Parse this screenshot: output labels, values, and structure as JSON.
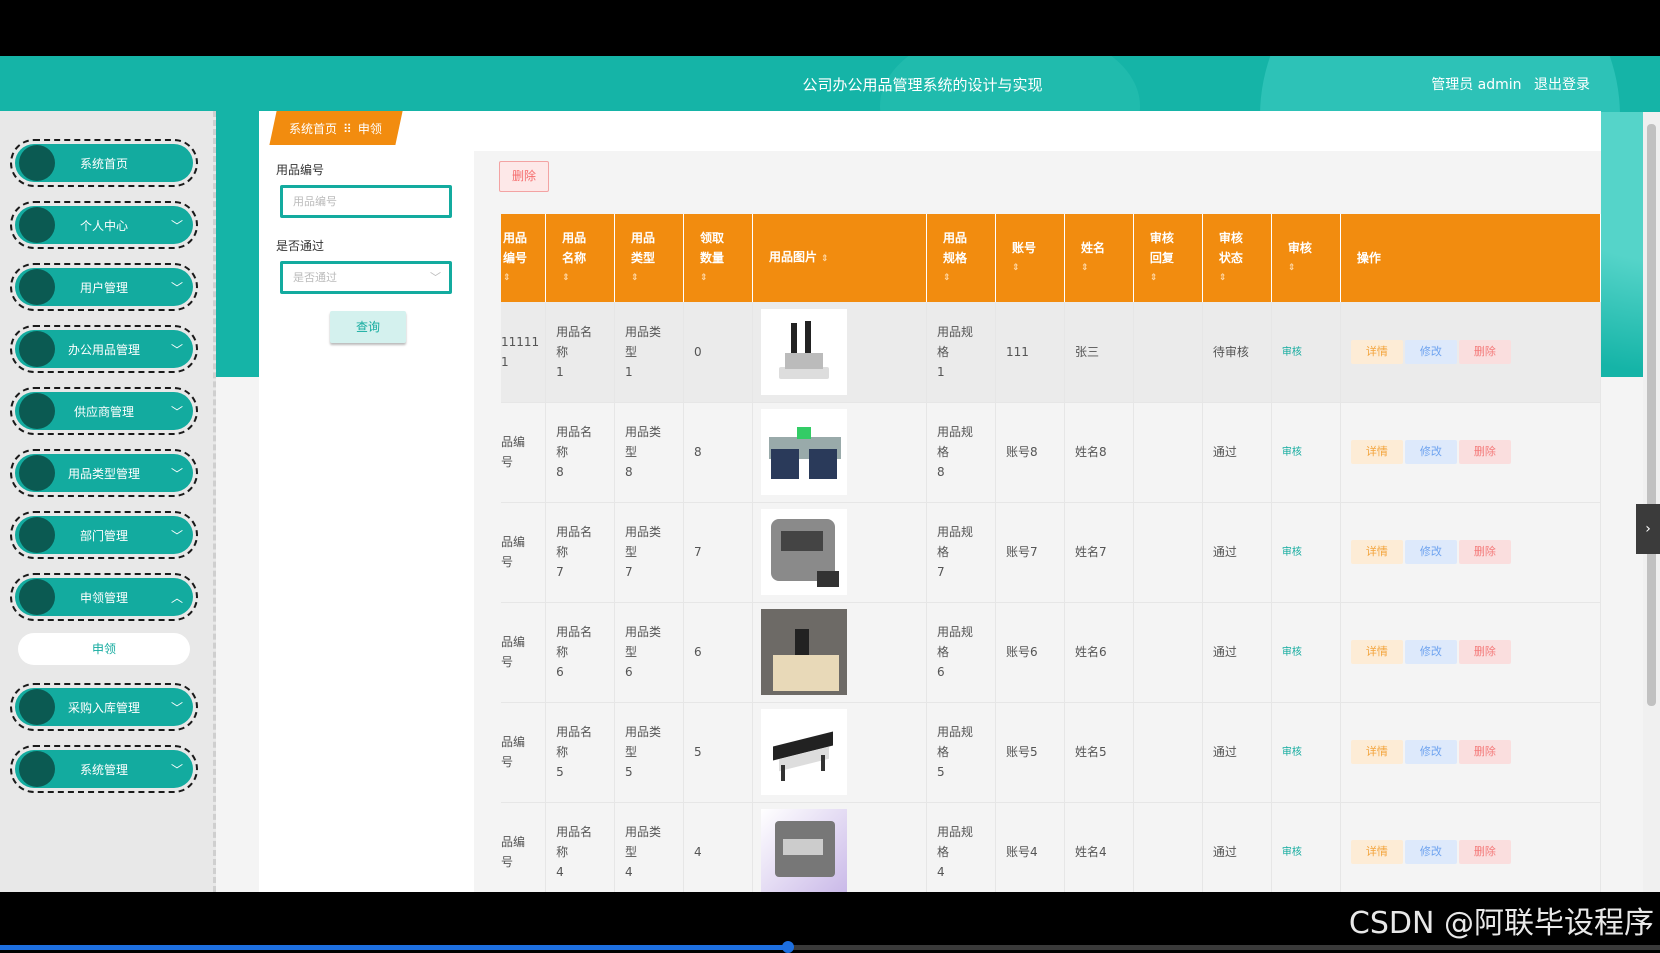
{
  "header": {
    "title": "公司办公用品管理系统的设计与实现",
    "role": "管理员 admin",
    "logout": "退出登录"
  },
  "sidebar": {
    "items": [
      {
        "label": "系统首页",
        "chevron": ""
      },
      {
        "label": "个人中心",
        "chevron": "﹀"
      },
      {
        "label": "用户管理",
        "chevron": "﹀"
      },
      {
        "label": "办公用品管理",
        "chevron": "﹀"
      },
      {
        "label": "供应商管理",
        "chevron": "﹀"
      },
      {
        "label": "用品类型管理",
        "chevron": "﹀"
      },
      {
        "label": "部门管理",
        "chevron": "﹀"
      },
      {
        "label": "申领管理",
        "chevron": "︿"
      },
      {
        "label": "采购入库管理",
        "chevron": "﹀"
      },
      {
        "label": "系统管理",
        "chevron": "﹀"
      }
    ],
    "submenu": "申领"
  },
  "breadcrumb": {
    "home": "系统首页",
    "sep": "⠿",
    "current": "申领"
  },
  "search": {
    "code_label": "用品编号",
    "code_placeholder": "用品编号",
    "pass_label": "是否通过",
    "pass_placeholder": "是否通过",
    "query": "查询"
  },
  "toolbar": {
    "delete": "删除"
  },
  "table": {
    "headers": {
      "code_l1": "用品",
      "code_l2": "编号",
      "name_l1": "用品",
      "name_l2": "名称",
      "type_l1": "用品",
      "type_l2": "类型",
      "qty_l1": "领取",
      "qty_l2": "数量",
      "img": "用品图片",
      "spec_l1": "用品",
      "spec_l2": "规格",
      "account": "账号",
      "realname": "姓名",
      "reply_l1": "审核",
      "reply_l2": "回复",
      "status_l1": "审核",
      "status_l2": "状态",
      "audit": "审核",
      "ops": "操作"
    },
    "sort_glyph": "⇕",
    "actions": {
      "detail": "详情",
      "edit": "修改",
      "delete": "删除",
      "audit": "审核"
    },
    "rows": [
      {
        "code": "11111\n1",
        "name": "用品名称\n1",
        "type": "用品类型\n1",
        "qty": "0",
        "spec": "用品规格\n1",
        "account": "111",
        "realname": "张三",
        "reply": "",
        "status": "待审核",
        "img": "stapler"
      },
      {
        "code": "品编号",
        "name": "用品名称\n8",
        "type": "用品类型\n8",
        "qty": "8",
        "spec": "用品规格\n8",
        "account": "账号8",
        "realname": "姓名8",
        "reply": "",
        "status": "通过",
        "img": "desk-set"
      },
      {
        "code": "品编号",
        "name": "用品名称\n7",
        "type": "用品类型\n7",
        "qty": "7",
        "spec": "用品规格\n7",
        "account": "账号7",
        "realname": "姓名7",
        "reply": "",
        "status": "通过",
        "img": "counter"
      },
      {
        "code": "品编号",
        "name": "用品名称\n6",
        "type": "用品类型\n6",
        "qty": "6",
        "spec": "用品规格\n6",
        "account": "账号6",
        "realname": "姓名6",
        "reply": "",
        "status": "通过",
        "img": "office-desk"
      },
      {
        "code": "品编号",
        "name": "用品名称\n5",
        "type": "用品类型\n5",
        "qty": "5",
        "spec": "用品规格\n5",
        "account": "账号5",
        "realname": "姓名5",
        "reply": "",
        "status": "通过",
        "img": "workstation"
      },
      {
        "code": "品编号",
        "name": "用品名称\n4",
        "type": "用品类型\n4",
        "qty": "4",
        "spec": "用品规格\n4",
        "account": "账号4",
        "realname": "姓名4",
        "reply": "",
        "status": "通过",
        "img": "printer"
      }
    ]
  },
  "side_toggle": "›",
  "watermark": "CSDN @阿联毕设程序",
  "colors": {
    "teal": "#15b4a7",
    "orange": "#f28c0f",
    "dark_teal": "#0b5a52"
  }
}
